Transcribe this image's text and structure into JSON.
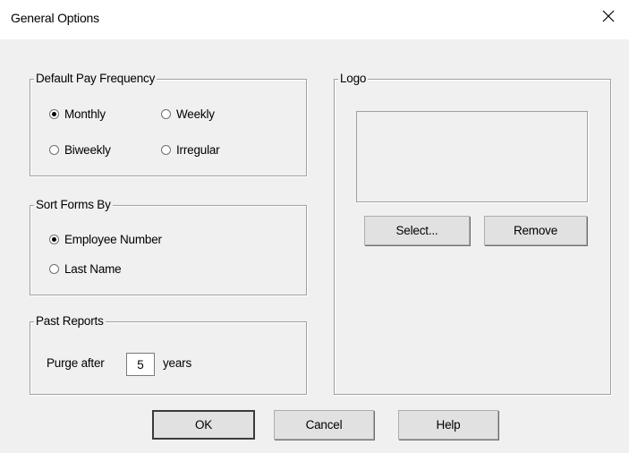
{
  "window": {
    "title": "General Options",
    "close_icon": "close-icon"
  },
  "pay_frequency": {
    "label": "Default Pay Frequency",
    "options": [
      {
        "label": "Monthly",
        "checked": true
      },
      {
        "label": "Weekly",
        "checked": false
      },
      {
        "label": "Biweekly",
        "checked": false
      },
      {
        "label": "Irregular",
        "checked": false
      }
    ]
  },
  "sort_forms": {
    "label": "Sort Forms By",
    "options": [
      {
        "label": "Employee Number",
        "checked": true
      },
      {
        "label": "Last Name",
        "checked": false
      }
    ]
  },
  "past_reports": {
    "label": "Past Reports",
    "prefix": "Purge after",
    "value": "5",
    "suffix": "years"
  },
  "logo": {
    "label": "Logo",
    "select_label": "Select...",
    "remove_label": "Remove"
  },
  "footer": {
    "ok_label": "OK",
    "cancel_label": "Cancel",
    "help_label": "Help"
  }
}
